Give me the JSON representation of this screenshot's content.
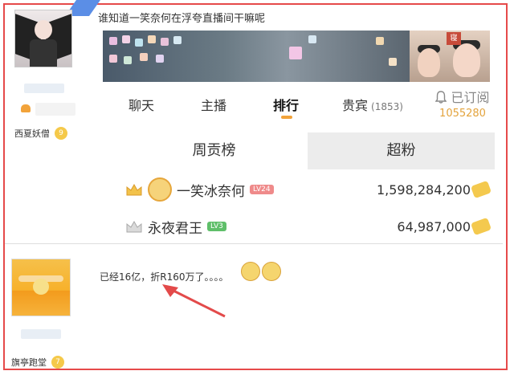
{
  "post": {
    "title": "谁知道一笑奈何在浮夸直播间干嘛呢",
    "user1_badge": "西夏妖僧",
    "user1_level": "9",
    "user2_badge": "旗亭跑堂",
    "user2_level": "7",
    "reply_text": "已经16亿，折R160万了。。。。"
  },
  "stream_tabs": {
    "chat": "聊天",
    "host": "主播",
    "rank": "排行",
    "vip": "贵宾",
    "vip_count": "(1853)"
  },
  "subscribe": {
    "label": "已订阅",
    "count": "1055280"
  },
  "rank_tabs": {
    "weekly": "周贡榜",
    "superfan": "超粉"
  },
  "ranking": [
    {
      "name": "一笑冰奈何",
      "level": "LV24",
      "value": "1,598,284,200",
      "level_color": "#ef8a8a"
    },
    {
      "name": "永夜君王",
      "level": "LV3",
      "value": "64,987,000",
      "level_color": "#5fbf6a"
    }
  ],
  "colors": {
    "border": "#e64a4a",
    "accent": "#f2a33a",
    "subscribe_count": "#e3a33c",
    "arrow": "#e34a4a"
  }
}
